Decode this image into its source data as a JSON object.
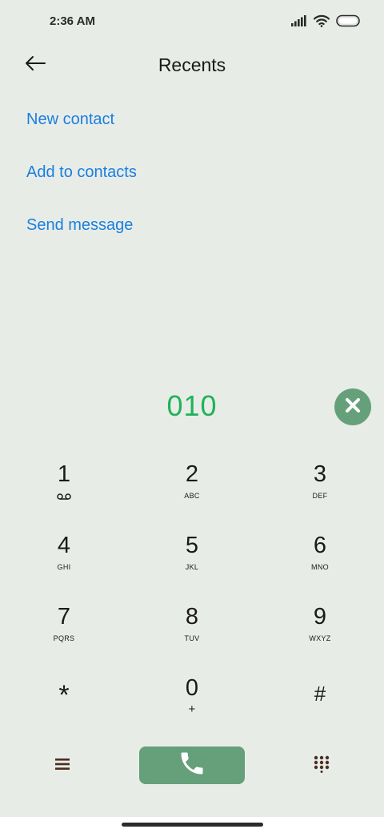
{
  "status_bar": {
    "time": "2:36 AM",
    "icons": [
      "signal-icon",
      "wifi-icon",
      "battery-icon"
    ]
  },
  "header": {
    "title": "Recents",
    "back_icon": "back-arrow-icon"
  },
  "actions": [
    {
      "label": "New contact"
    },
    {
      "label": "Add to contacts"
    },
    {
      "label": "Send message"
    }
  ],
  "dialer": {
    "number": "010",
    "clear_icon": "close-icon"
  },
  "keypad": {
    "keys": [
      {
        "digit": "1",
        "letters": "",
        "sub_icon": "voicemail-icon"
      },
      {
        "digit": "2",
        "letters": "ABC"
      },
      {
        "digit": "3",
        "letters": "DEF"
      },
      {
        "digit": "4",
        "letters": "GHI"
      },
      {
        "digit": "5",
        "letters": "JKL"
      },
      {
        "digit": "6",
        "letters": "MNO"
      },
      {
        "digit": "7",
        "letters": "PQRS"
      },
      {
        "digit": "8",
        "letters": "TUV"
      },
      {
        "digit": "9",
        "letters": "WXYZ"
      },
      {
        "digit": "*",
        "letters": ""
      },
      {
        "digit": "0",
        "letters": "+"
      },
      {
        "digit": "#",
        "letters": ""
      }
    ]
  },
  "bottom_bar": {
    "menu_icon": "menu-icon",
    "call_icon": "phone-icon",
    "dialpad_icon": "dialpad-icon"
  },
  "colors": {
    "background": "#e8ece7",
    "accent_link": "#1a7fe0",
    "number_text": "#1fb25a",
    "button_green": "#65a07a",
    "icon_dark": "#4a2e22"
  }
}
